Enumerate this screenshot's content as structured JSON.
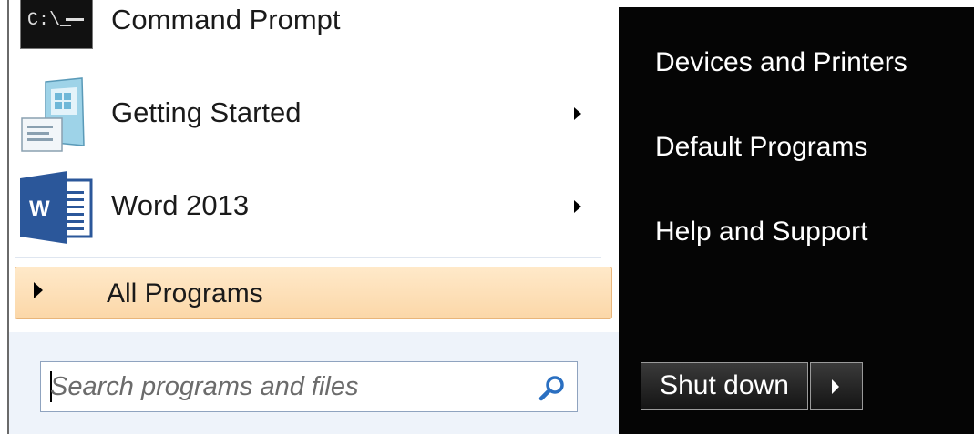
{
  "programs": [
    {
      "label": "Command Prompt",
      "icon": "command-prompt-icon",
      "has_submenu": false
    },
    {
      "label": "Getting Started",
      "icon": "getting-started-icon",
      "has_submenu": true
    },
    {
      "label": "Word 2013",
      "icon": "word-icon",
      "icon_letter": "W",
      "has_submenu": true
    }
  ],
  "all_programs": {
    "label": "All Programs"
  },
  "search": {
    "placeholder": "Search programs and files",
    "icon": "search-icon"
  },
  "right_menu": [
    {
      "label": "Devices and Printers"
    },
    {
      "label": "Default Programs"
    },
    {
      "label": "Help and Support"
    }
  ],
  "shutdown": {
    "label": "Shut down",
    "arrow_icon": "chevron-right-icon"
  },
  "colors": {
    "right_pane": "#050505",
    "highlight": "#fbd7a8",
    "word_blue": "#2b579a"
  }
}
